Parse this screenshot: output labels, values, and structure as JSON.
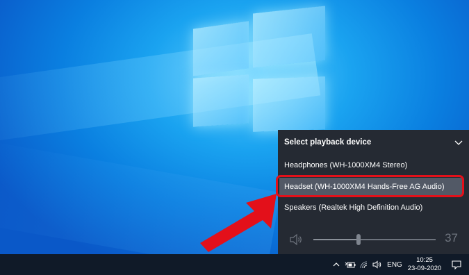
{
  "flyout": {
    "title": "Select playback device",
    "devices": [
      {
        "label": "Headphones (WH-1000XM4 Stereo)",
        "selected": false
      },
      {
        "label": "Headset (WH-1000XM4 Hands-Free AG Audio)",
        "selected": true
      },
      {
        "label": "Speakers (Realtek High Definition Audio)",
        "selected": false
      }
    ],
    "volume": {
      "value": "37",
      "fraction": 0.37,
      "icon": "speaker-icon"
    }
  },
  "taskbar": {
    "tray_icons": [
      "chevron-up-icon",
      "bluetooth-battery-icon",
      "wifi-icon",
      "speaker-icon"
    ],
    "language": "ENG",
    "time": "10:25",
    "date": "23-09-2020",
    "notification_icon": "action-center-icon"
  },
  "annotation": {
    "highlight_color": "#e3101a",
    "arrow_color": "#e3101a"
  },
  "colors": {
    "flyout_bg": "#252a33",
    "selected_bg": "#525966",
    "taskbar_bg": "#101a28"
  }
}
